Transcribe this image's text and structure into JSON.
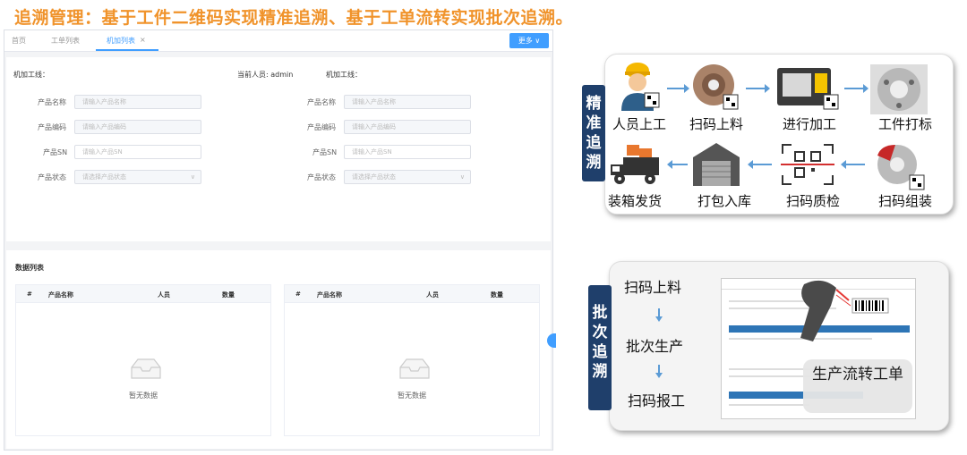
{
  "headline": "追溯管理：基于工件二维码实现精准追溯、基于工单流转实现批次追溯。",
  "app": {
    "tabs": [
      "首页",
      "工单列表",
      "机加列表"
    ],
    "tab_close": "×",
    "more_button": "更多 ∨",
    "info": {
      "line_left": "机加工线：",
      "operator": "当前人员: admin",
      "line_right": "机加工线："
    },
    "form": {
      "product_name_label": "产品名称",
      "product_name_placeholder": "请输入产品名称",
      "product_code_label": "产品编码",
      "product_code_placeholder": "请输入产品编码",
      "product_sn_label": "产品SN",
      "product_sn_placeholder": "请输入产品SN",
      "product_status_label": "产品状态",
      "product_status_placeholder": "请选择产品状态"
    },
    "data_list_title": "数据列表",
    "table_headers": [
      "#",
      "产品名称",
      "人员",
      "数量"
    ],
    "empty_text": "暂无数据"
  },
  "precise": {
    "label": "精准追溯",
    "steps_top": [
      "人员上工",
      "扫码上料",
      "进行加工",
      "工件打标"
    ],
    "steps_bottom": [
      "装箱发货",
      "打包入库",
      "扫码质检",
      "扫码组装"
    ]
  },
  "batch": {
    "label": "批次追溯",
    "steps": [
      "扫码上料",
      "批次生产",
      "扫码报工"
    ],
    "callout": "生产流转工单"
  },
  "colors": {
    "headline": "#f0932b",
    "accent": "#409eff",
    "label_bg": "#1f3f6b",
    "arrow": "#5b9bd5"
  }
}
